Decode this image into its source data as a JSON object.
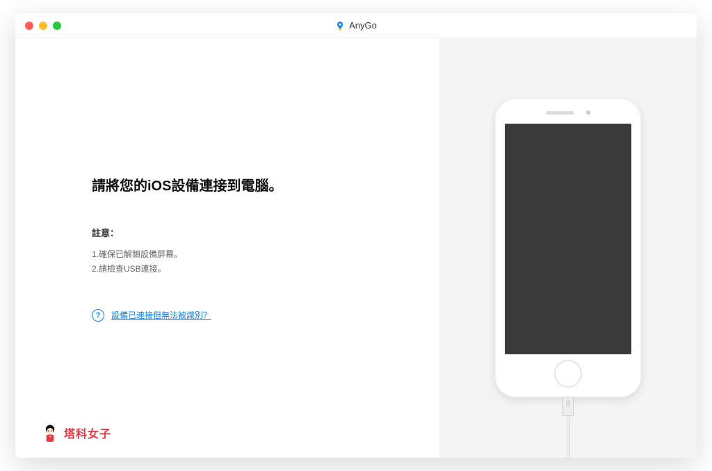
{
  "titlebar": {
    "app_name": "AnyGo"
  },
  "main": {
    "heading": "請將您的iOS設備連接到電腦。",
    "note_label": "註意：",
    "note1": "1.確保已解鎖設備屏幕。",
    "note2": "2.請檢查USB連接。",
    "help_link": "設備已連接但無法被識別？"
  },
  "watermark": {
    "text": "塔科女子"
  }
}
